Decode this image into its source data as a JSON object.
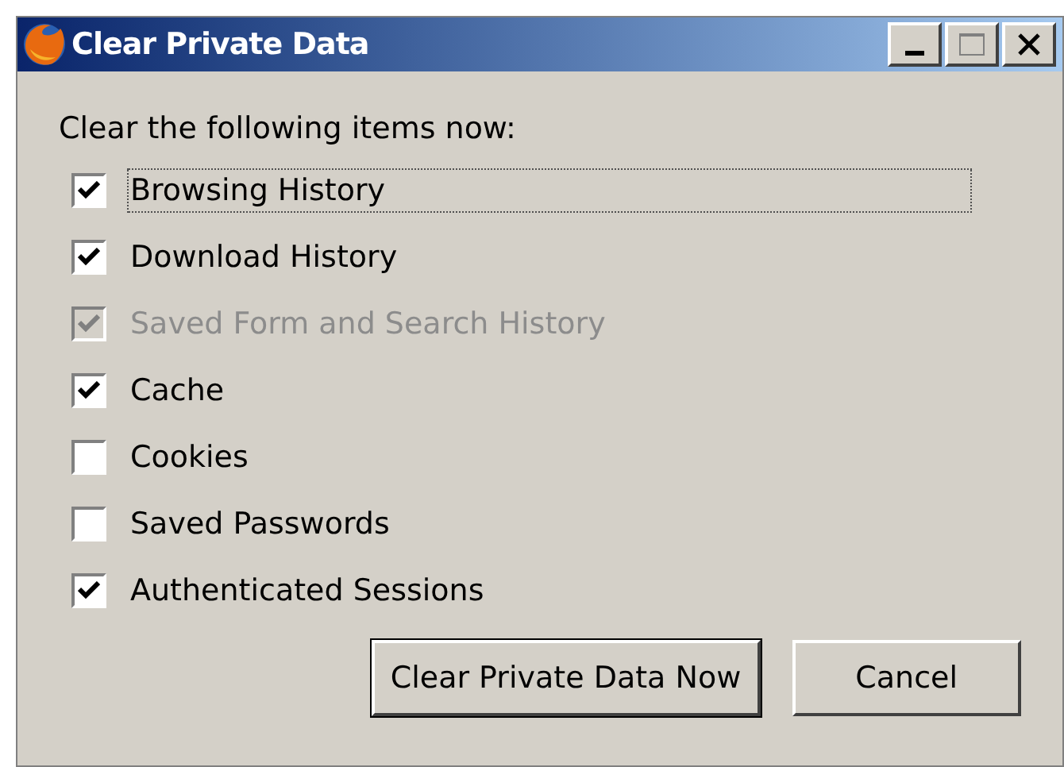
{
  "window": {
    "title": "Clear Private Data"
  },
  "heading": "Clear the following items now:",
  "items": [
    {
      "label": "Browsing History",
      "checked": true,
      "disabled": false,
      "focused": true
    },
    {
      "label": "Download History",
      "checked": true,
      "disabled": false,
      "focused": false
    },
    {
      "label": "Saved Form and Search History",
      "checked": true,
      "disabled": true,
      "focused": false
    },
    {
      "label": "Cache",
      "checked": true,
      "disabled": false,
      "focused": false
    },
    {
      "label": "Cookies",
      "checked": false,
      "disabled": false,
      "focused": false
    },
    {
      "label": "Saved Passwords",
      "checked": false,
      "disabled": false,
      "focused": false
    },
    {
      "label": "Authenticated Sessions",
      "checked": true,
      "disabled": false,
      "focused": false
    }
  ],
  "buttons": [
    {
      "label": "Clear Private Data Now",
      "default": true
    },
    {
      "label": "Cancel",
      "default": false
    }
  ]
}
